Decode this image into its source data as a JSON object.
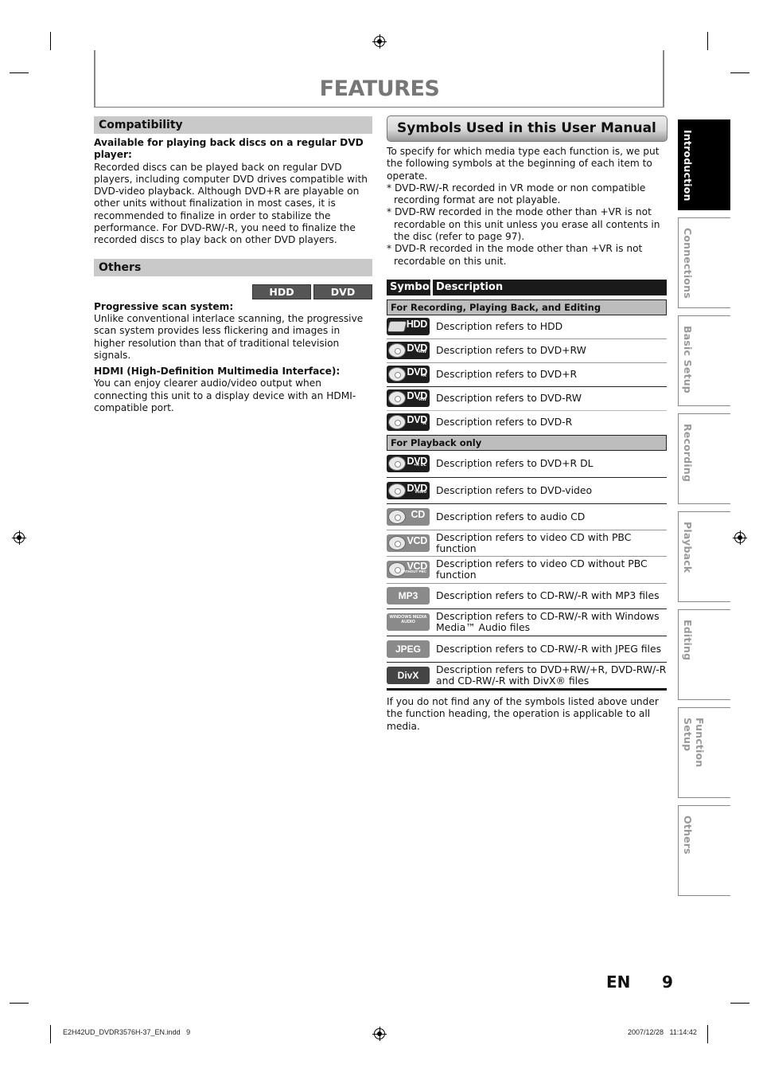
{
  "page": {
    "title": "FEATURES",
    "language_label": "EN",
    "page_number": "9"
  },
  "compatibility": {
    "heading": "Compatibility",
    "subheading": "Available for playing back discs on a regular DVD player:",
    "body": "Recorded discs can be played back on regular DVD players, including computer DVD drives compatible with DVD-video playback. Although DVD+R are playable on other units without finalization in most cases, it is recommended to finalize in order to stabilize the performance. For DVD-RW/-R, you need to finalize the recorded discs to play back on other DVD players."
  },
  "others": {
    "heading": "Others",
    "badges": [
      "HDD",
      "DVD"
    ],
    "items": [
      {
        "title": "Progressive scan system:",
        "body": "Unlike conventional interlace scanning, the progressive scan system provides less flickering and images in higher resolution than that of traditional television signals."
      },
      {
        "title": "HDMI (High-Definition Multimedia Interface):",
        "body": "You can enjoy clearer audio/video output when connecting this unit to a display device with an HDMI-compatible port."
      }
    ]
  },
  "symbols": {
    "heading": "Symbols Used in this User Manual",
    "intro": "To specify for which media type each function is, we put the following symbols at the beginning of each item to operate.",
    "notes": [
      "* DVD-RW/-R recorded in VR mode or non compatible recording format are not playable.",
      "* DVD-RW recorded in the mode other than +VR is not recordable on this unit unless you erase all contents in the disc (refer to page 97).",
      "* DVD-R recorded in the mode other than +VR is not recordable on this unit."
    ],
    "table": {
      "col_symbol": "Symbol",
      "col_description": "Description",
      "group_recording": "For Recording, Playing Back, and Editing",
      "group_playback": "For Playback only",
      "recording_rows": [
        {
          "icon": "hdd-icon",
          "label": "HDD",
          "sub": "",
          "desc": "Description refers to HDD"
        },
        {
          "icon": "dvd-plus-rw-icon",
          "label": "DVD",
          "sub": "+RW",
          "desc": "Description refers to DVD+RW"
        },
        {
          "icon": "dvd-plus-r-icon",
          "label": "DVD",
          "sub": "+R",
          "desc": "Description refers to DVD+R"
        },
        {
          "icon": "dvd-minus-rw-icon",
          "label": "DVD",
          "sub": "-RW",
          "desc": "Description refers to DVD-RW"
        },
        {
          "icon": "dvd-minus-r-icon",
          "label": "DVD",
          "sub": "-R",
          "desc": "Description refers to DVD-R"
        }
      ],
      "playback_rows": [
        {
          "icon": "dvd-plus-r-dl-icon",
          "label": "DVD",
          "sub": "+R DL",
          "desc": "Description refers to DVD+R DL"
        },
        {
          "icon": "dvd-video-icon",
          "label": "DVD",
          "sub": "Video",
          "desc": "Description refers to DVD-video"
        },
        {
          "icon": "audio-cd-icon",
          "label": "CD",
          "sub": "",
          "desc": "Description refers to audio CD"
        },
        {
          "icon": "vcd-icon",
          "label": "VCD",
          "sub": "",
          "desc": "Description refers to video CD with PBC function"
        },
        {
          "icon": "vcd-without-pbc-icon",
          "label": "VCD",
          "sub": "WITHOUT PBC",
          "desc": "Description refers to video CD without PBC function"
        },
        {
          "icon": "mp3-icon",
          "label": "MP3",
          "sub": "",
          "desc": "Description refers to CD-RW/-R with MP3 files"
        },
        {
          "icon": "wma-icon",
          "label": "WINDOWS MEDIA AUDIO",
          "sub": "",
          "desc": "Description refers to CD-RW/-R with Windows Media™ Audio files"
        },
        {
          "icon": "jpeg-icon",
          "label": "JPEG",
          "sub": "",
          "desc": "Description refers to CD-RW/-R with JPEG files"
        },
        {
          "icon": "divx-icon",
          "label": "DivX",
          "sub": "",
          "desc": "Description refers to DVD+RW/+R, DVD-RW/-R and CD-RW/-R with DivX® files"
        }
      ]
    },
    "footnote": "If you do not find any of the symbols listed above under the function heading, the operation is applicable to all media."
  },
  "tabs": [
    {
      "label": "Introduction",
      "active": true
    },
    {
      "label": "Connections",
      "active": false
    },
    {
      "label": "Basic Setup",
      "active": false
    },
    {
      "label": "Recording",
      "active": false
    },
    {
      "label": "Playback",
      "active": false
    },
    {
      "label": "Editing",
      "active": false
    },
    {
      "label": "Function Setup",
      "active": false
    },
    {
      "label": "Others",
      "active": false
    }
  ],
  "slug": {
    "file": "E2H42UD_DVDR3576H-37_EN.indd   9",
    "datetime": "2007/12/28   11:14:42"
  },
  "colors": {
    "title_gray": "#777777",
    "section_head_bg": "#c9c9c9",
    "active_tab_bg": "#000000",
    "badge_bg": "#555555"
  }
}
